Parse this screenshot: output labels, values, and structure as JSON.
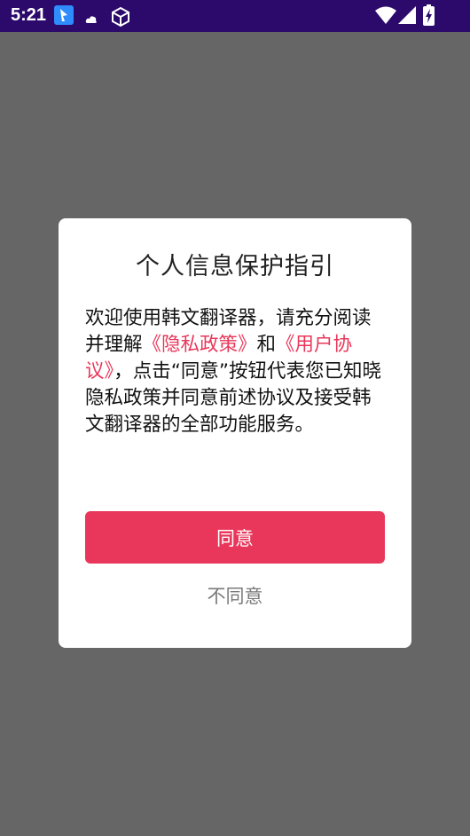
{
  "status_bar": {
    "time": "5:21",
    "icons": [
      "app-notification-icon",
      "cloud-icon",
      "cube-icon",
      "wifi-icon",
      "signal-icon",
      "battery-charging-icon"
    ]
  },
  "dialog": {
    "title": "个人信息保护指引",
    "body": {
      "p1": "欢迎使用韩文翻译器，请充分阅读并理解",
      "privacy_link": "《隐私政策》",
      "p2": "和",
      "user_link": "《用户协议》",
      "p3": "，点击“同意”按钮代表您已知晓隐私政策并同意前述协议及接受韩文翻译器的全部功能服务。"
    },
    "agree_label": "同意",
    "disagree_label": "不同意"
  },
  "colors": {
    "status_bar": "#2b0a6b",
    "overlay": "#666666",
    "accent": "#e8375a",
    "disagree_text": "#7a7a7a"
  }
}
